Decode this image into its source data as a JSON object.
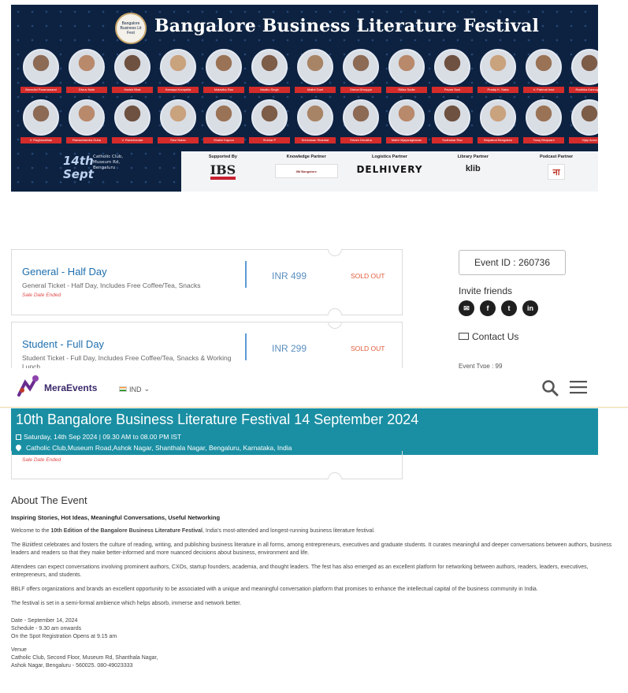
{
  "banner": {
    "title": "Bangalore Business Literature Festival",
    "logo_text": "Bangalore Business Lit Fest",
    "date": "14th Sept",
    "venue": "Catholic Club, Museum Rd, Bengaluru",
    "speakers_row1": [
      "Benedict Paramanand",
      "Dhruv Nath",
      "Harish Bhat",
      "Kamaya Kompella",
      "Malavika Rao",
      "Madhu Singh",
      "Malini Goel",
      "Shriva Dhruppa",
      "Ritika Sudle",
      "Pavan Soni",
      "Pradip K. Saha",
      "V. Parimal Iravi",
      "Radhika Kannupadi"
    ],
    "speakers_row2": [
      "V. Raghunathan",
      "Ramachandra Guha",
      "V. Ravichandar",
      "Ravi Naidu",
      "Shalini Kapoor",
      "Shekar P",
      "Srinivasan Shankar",
      "Sriram Devatha",
      "Mathi Vijayaraghavan",
      "Sudhakar Rao",
      "Satyabrat Bengaluru",
      "Tanuj Bhojwani",
      "Vijay Arora"
    ],
    "partners": [
      {
        "label": "Supported By",
        "logo": "IBS"
      },
      {
        "label": "Knowledge Partner",
        "logo": "IIM Bangalore"
      },
      {
        "label": "Logistics Partner",
        "logo": "DELHIVERY"
      },
      {
        "label": "Library Partner",
        "logo": "klib"
      },
      {
        "label": "Podcast Partner",
        "logo": "ना"
      }
    ]
  },
  "tickets": [
    {
      "name": "General - Half Day",
      "desc": "General Ticket - Half Day, Includes Free Coffee/Tea, Snacks",
      "sale": "Sale Date Ended",
      "price": "INR 499",
      "status": "SOLD OUT"
    },
    {
      "name": "Student - Full Day",
      "desc": "Student Ticket - Full Day, Includes Free Coffee/Tea, Snacks & Working Lunch",
      "sale": "",
      "price": "INR 299",
      "status": "SOLD OUT"
    },
    {
      "sale": "Sale Date Ended"
    }
  ],
  "sidebar": {
    "event_id": "Event ID : 260736",
    "invite": "Invite friends",
    "social": [
      "email-icon",
      "facebook-icon",
      "twitter-icon",
      "linkedin-icon"
    ],
    "contact": "Contact Us",
    "partial": "Event Type : 99"
  },
  "nav": {
    "brand": "MeraEvents",
    "country": "IND"
  },
  "hero": {
    "title": "10th Bangalore Business Literature Festival 14 September 2024",
    "date": "Saturday, 14th Sep 2024 | 09.30 AM to 08.00 PM IST",
    "location": "Catholic Club,Museum Road,Ashok Nagar, Shanthala Nagar, Bengaluru, Karnataka, India"
  },
  "about": {
    "heading": "About The Event",
    "tagline": "Inspiring Stories, Hot Ideas, Meaningful Conversations, Useful Networking",
    "welcome_pre": "Welcome to the ",
    "welcome_bold": "10th Edition of the Bangalore Business Literature Festival",
    "welcome_post": ", India's most-attended and longest-running business literature festival.",
    "p1": "The Biziitfest celebrates and fosters the culture of reading, writing, and publishing business literature in all forms, among entrepreneurs, executives and graduate students. It curates meaningful and deeper conversations between authors, business leaders and readers so that they make better-informed and more nuanced decisions about business, environment and life.",
    "p2": "Attendees can expect conversations involving prominent authors, CXOs, startup founders, academia, and thought leaders. The fest has also emerged as an excellent platform for networking between authors, readers, leaders, executives, entrepreneurs, and students.",
    "p3": "BBLF offers organizations and brands an excellent opportunity to be associated with a unique and meaningful conversation platform that promises to enhance the intellectual capital of the business community in India.",
    "p4": "The festival is set in a semi-formal ambience which helps absorb, immerse and network better.",
    "date_line": "Date - September 14, 2024",
    "schedule_line": "Schedule - 9.30 am onwards",
    "spot_line": "On the Spot Registration Opens at 9.15 am",
    "venue_label": "Venue",
    "venue_line1": "Catholic Club, Second Floor, Museum Rd, Shanthala Nagar,",
    "venue_line2": "Ashok Nagar, Bengaluru - 560025. 080-49023333"
  },
  "colors": {
    "banner_bg": "#0d2240",
    "hero_bg": "#1a8fa3",
    "link": "#1e6fae",
    "sold_out": "#e05a3a",
    "brand": "#3b2a6b"
  }
}
